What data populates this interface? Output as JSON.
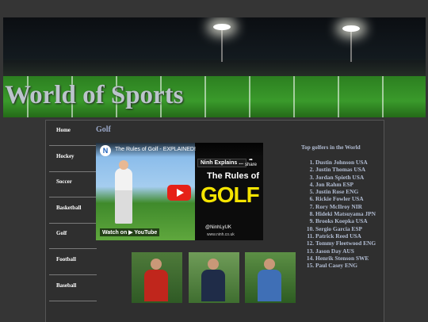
{
  "site": {
    "title": "World of Sports"
  },
  "nav": {
    "items": [
      {
        "label": "Home"
      },
      {
        "label": "Hockey"
      },
      {
        "label": "Soccer"
      },
      {
        "label": "Basketball"
      },
      {
        "label": "Golf"
      },
      {
        "label": "Football"
      },
      {
        "label": "Baseball"
      }
    ]
  },
  "main": {
    "section_title": "Golf",
    "video": {
      "title": "The Rules of Golf - EXPLAINED!",
      "channel_badge": "Ninh Explains ...",
      "share_label": "share",
      "thumbnail_heading": "The Rules of",
      "thumbnail_word": "GOLF",
      "watch_label": "Watch on ▶ YouTube",
      "handle": "@NinhLyUK",
      "site": "www.ninh.co.uk",
      "logo_letter": "N"
    },
    "list_title": "Top golfers in the World",
    "golfers": [
      "Dustin Johnson USA",
      "Justin Thomas USA",
      "Jordan Spieth USA",
      "Jon Rahm ESP",
      "Justin Rose ENG",
      "Rickie Fowler USA",
      "Rory McIlroy NIR",
      "Hideki Matsuyama JPN",
      "Brooks Koepka USA",
      "Sergio Garcia ESP",
      "Patrick Reed USA",
      "Tommy Fleetwood ENG",
      "Jason Day AUS",
      "Henrik Stenson SWE",
      "Paul Casey ENG"
    ]
  },
  "colors": {
    "page_bg": "#353535",
    "content_bg": "#2f2f2f",
    "text_blue": "#b2bdd3",
    "youtube_red": "#e62117",
    "golf_yellow": "#f5e400"
  }
}
